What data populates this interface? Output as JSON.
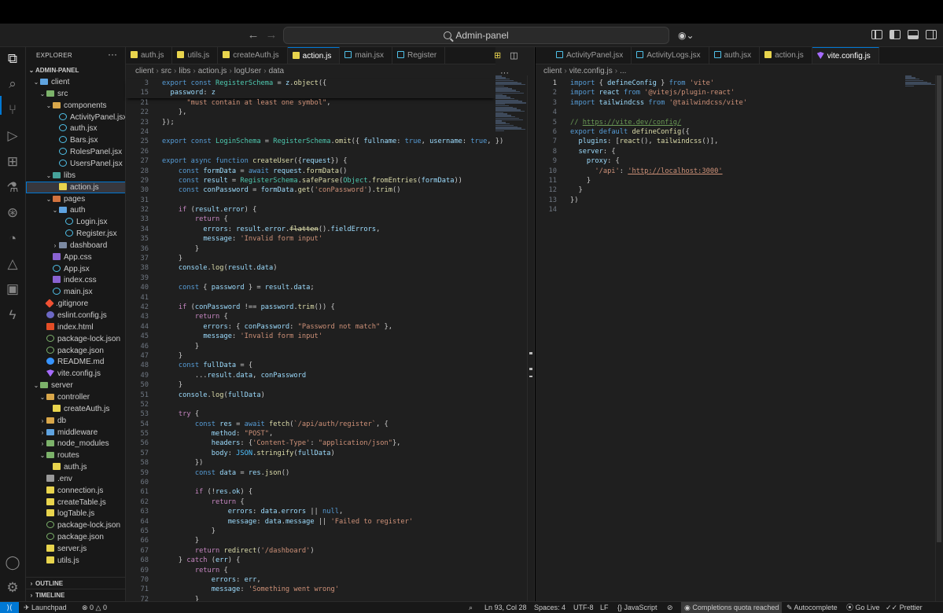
{
  "titlebar": {
    "search_text": "Admin-panel",
    "back_icon": "arrow-left-icon",
    "forward_icon": "arrow-right-icon",
    "copilot_icon": "copilot-icon"
  },
  "activity_bar": {
    "items": [
      "explorer-icon",
      "search-icon",
      "source-control-icon",
      "run-debug-icon",
      "extensions-icon",
      "testing-icon",
      "git-graph-icon",
      "remote-icon",
      "azure-icon",
      "container-icon",
      "thunder-client-icon"
    ],
    "bottom": [
      "account-icon",
      "settings-gear-icon"
    ]
  },
  "sidebar": {
    "title": "EXPLORER",
    "more": "···",
    "root": "ADMIN-PANEL",
    "tree": [
      {
        "label": "client",
        "depth": 1,
        "chev": "⌄",
        "icon": "ic-folder-blue"
      },
      {
        "label": "src",
        "depth": 2,
        "chev": "⌄",
        "icon": "ic-folder-green"
      },
      {
        "label": "components",
        "depth": 3,
        "chev": "⌄",
        "icon": "ic-folder"
      },
      {
        "label": "ActivityPanel.jsx",
        "depth": 4,
        "chev": "",
        "icon": "ic-react"
      },
      {
        "label": "auth.jsx",
        "depth": 4,
        "chev": "",
        "icon": "ic-react"
      },
      {
        "label": "Bars.jsx",
        "depth": 4,
        "chev": "",
        "icon": "ic-react"
      },
      {
        "label": "RolesPanel.jsx",
        "depth": 4,
        "chev": "",
        "icon": "ic-react"
      },
      {
        "label": "UsersPanel.jsx",
        "depth": 4,
        "chev": "",
        "icon": "ic-react"
      },
      {
        "label": "libs",
        "depth": 3,
        "chev": "⌄",
        "icon": "ic-folder-teal"
      },
      {
        "label": "action.js",
        "depth": 4,
        "chev": "",
        "icon": "ic-js",
        "selected": true
      },
      {
        "label": "pages",
        "depth": 3,
        "chev": "⌄",
        "icon": "ic-folder-red"
      },
      {
        "label": "auth",
        "depth": 4,
        "chev": "⌄",
        "icon": "ic-folder-blue"
      },
      {
        "label": "Login.jsx",
        "depth": 5,
        "chev": "",
        "icon": "ic-react"
      },
      {
        "label": "Register.jsx",
        "depth": 5,
        "chev": "",
        "icon": "ic-react"
      },
      {
        "label": "dashboard",
        "depth": 4,
        "chev": "›",
        "icon": "ic-folder-gray"
      },
      {
        "label": "App.css",
        "depth": 3,
        "chev": "",
        "icon": "ic-css"
      },
      {
        "label": "App.jsx",
        "depth": 3,
        "chev": "",
        "icon": "ic-react"
      },
      {
        "label": "index.css",
        "depth": 3,
        "chev": "",
        "icon": "ic-css"
      },
      {
        "label": "main.jsx",
        "depth": 3,
        "chev": "",
        "icon": "ic-react"
      },
      {
        "label": ".gitignore",
        "depth": 2,
        "chev": "",
        "icon": "ic-git"
      },
      {
        "label": "eslint.config.js",
        "depth": 2,
        "chev": "",
        "icon": "ic-eslint"
      },
      {
        "label": "index.html",
        "depth": 2,
        "chev": "",
        "icon": "ic-html"
      },
      {
        "label": "package-lock.json",
        "depth": 2,
        "chev": "",
        "icon": "ic-json"
      },
      {
        "label": "package.json",
        "depth": 2,
        "chev": "",
        "icon": "ic-json"
      },
      {
        "label": "README.md",
        "depth": 2,
        "chev": "",
        "icon": "ic-info"
      },
      {
        "label": "vite.config.js",
        "depth": 2,
        "chev": "",
        "icon": "ic-vite"
      },
      {
        "label": "server",
        "depth": 1,
        "chev": "⌄",
        "icon": "ic-folder-green"
      },
      {
        "label": "controller",
        "depth": 2,
        "chev": "⌄",
        "icon": "ic-folder"
      },
      {
        "label": "createAuth.js",
        "depth": 3,
        "chev": "",
        "icon": "ic-js"
      },
      {
        "label": "db",
        "depth": 2,
        "chev": "›",
        "icon": "ic-folder"
      },
      {
        "label": "middleware",
        "depth": 2,
        "chev": "›",
        "icon": "ic-folder-blue"
      },
      {
        "label": "node_modules",
        "depth": 2,
        "chev": "›",
        "icon": "ic-folder-green"
      },
      {
        "label": "routes",
        "depth": 2,
        "chev": "⌄",
        "icon": "ic-folder-green"
      },
      {
        "label": "auth.js",
        "depth": 3,
        "chev": "",
        "icon": "ic-js"
      },
      {
        "label": ".env",
        "depth": 2,
        "chev": "",
        "icon": "ic-env"
      },
      {
        "label": "connection.js",
        "depth": 2,
        "chev": "",
        "icon": "ic-js"
      },
      {
        "label": "createTable.js",
        "depth": 2,
        "chev": "",
        "icon": "ic-js"
      },
      {
        "label": "logTable.js",
        "depth": 2,
        "chev": "",
        "icon": "ic-js"
      },
      {
        "label": "package-lock.json",
        "depth": 2,
        "chev": "",
        "icon": "ic-json"
      },
      {
        "label": "package.json",
        "depth": 2,
        "chev": "",
        "icon": "ic-json"
      },
      {
        "label": "server.js",
        "depth": 2,
        "chev": "",
        "icon": "ic-js"
      },
      {
        "label": "utils.js",
        "depth": 2,
        "chev": "",
        "icon": "ic-js"
      }
    ],
    "outline": "OUTLINE",
    "timeline": "TIMELINE"
  },
  "editor_left": {
    "tabs": [
      {
        "label": "auth.js",
        "icon": "ic-js",
        "active": false
      },
      {
        "label": "utils.js",
        "icon": "ic-js",
        "active": false
      },
      {
        "label": "createAuth.js",
        "icon": "ic-js",
        "active": false
      },
      {
        "label": "action.js",
        "icon": "ic-js",
        "active": true
      },
      {
        "label": "main.jsx",
        "icon": "ic-react",
        "active": false
      },
      {
        "label": "Register",
        "icon": "ic-react",
        "active": false
      }
    ],
    "breadcrumb": [
      "client",
      "src",
      "libs",
      "action.js",
      "logUser",
      "data"
    ],
    "sticky": [
      {
        "n": "3",
        "t": "export const RegisterSchema = z.object({"
      },
      {
        "n": "15",
        "t": "  password: z"
      }
    ],
    "lines": [
      {
        "n": "21",
        "t": "      \"must contain at least one symbol\","
      },
      {
        "n": "22",
        "t": "    },"
      },
      {
        "n": "23",
        "t": "});"
      },
      {
        "n": "24",
        "t": ""
      },
      {
        "n": "25",
        "t": "export const LoginSchema = RegisterSchema.omit({ fullname: true, username: true, })"
      },
      {
        "n": "26",
        "t": ""
      },
      {
        "n": "27",
        "t": "export async function createUser({request}) {"
      },
      {
        "n": "28",
        "t": "    const formData = await request.formData()"
      },
      {
        "n": "29",
        "t": "    const result = RegisterSchema.safeParse(Object.fromEntries(formData))"
      },
      {
        "n": "30",
        "t": "    const conPassword = formData.get('conPassword').trim()"
      },
      {
        "n": "31",
        "t": ""
      },
      {
        "n": "32",
        "t": "    if (result.error) {"
      },
      {
        "n": "33",
        "t": "        return {"
      },
      {
        "n": "34",
        "t": "          errors: result.error.flatten().fieldErrors,"
      },
      {
        "n": "35",
        "t": "          message: 'Invalid form input'"
      },
      {
        "n": "36",
        "t": "        }"
      },
      {
        "n": "37",
        "t": "    }"
      },
      {
        "n": "38",
        "t": "    console.log(result.data)"
      },
      {
        "n": "39",
        "t": ""
      },
      {
        "n": "40",
        "t": "    const { password } = result.data;"
      },
      {
        "n": "41",
        "t": ""
      },
      {
        "n": "42",
        "t": "    if (conPassword !== password.trim()) {"
      },
      {
        "n": "43",
        "t": "        return {"
      },
      {
        "n": "44",
        "t": "          errors: { conPassword: \"Password not match\" },"
      },
      {
        "n": "45",
        "t": "          message: 'Invalid form input'"
      },
      {
        "n": "46",
        "t": "        }"
      },
      {
        "n": "47",
        "t": "    }"
      },
      {
        "n": "48",
        "t": "    const fullData = {"
      },
      {
        "n": "49",
        "t": "        ...result.data, conPassword"
      },
      {
        "n": "50",
        "t": "    }"
      },
      {
        "n": "51",
        "t": "    console.log(fullData)"
      },
      {
        "n": "52",
        "t": ""
      },
      {
        "n": "53",
        "t": "    try {"
      },
      {
        "n": "54",
        "t": "        const res = await fetch(`/api/auth/register`, {"
      },
      {
        "n": "55",
        "t": "            method: \"POST\","
      },
      {
        "n": "56",
        "t": "            headers: {'Content-Type': \"application/json\"},"
      },
      {
        "n": "57",
        "t": "            body: JSON.stringify(fullData)"
      },
      {
        "n": "58",
        "t": "        })"
      },
      {
        "n": "59",
        "t": "        const data = res.json()"
      },
      {
        "n": "60",
        "t": ""
      },
      {
        "n": "61",
        "t": "        if (!res.ok) {"
      },
      {
        "n": "62",
        "t": "            return {"
      },
      {
        "n": "63",
        "t": "                errors: data.errors || null,"
      },
      {
        "n": "64",
        "t": "                message: data.message || 'Failed to register'"
      },
      {
        "n": "65",
        "t": "            }"
      },
      {
        "n": "66",
        "t": "        }"
      },
      {
        "n": "67",
        "t": "        return redirect('/dashboard')"
      },
      {
        "n": "68",
        "t": "    } catch (err) {"
      },
      {
        "n": "69",
        "t": "        return {"
      },
      {
        "n": "70",
        "t": "            errors: err,"
      },
      {
        "n": "71",
        "t": "            message: 'Something went wrong'"
      },
      {
        "n": "72",
        "t": "        }"
      }
    ]
  },
  "editor_right": {
    "tabs": [
      {
        "label": "ActivityPanel.jsx",
        "icon": "ic-react",
        "active": false
      },
      {
        "label": "ActivityLogs.jsx",
        "icon": "ic-react",
        "active": false
      },
      {
        "label": "auth.jsx",
        "icon": "ic-react",
        "active": false
      },
      {
        "label": "action.js",
        "icon": "ic-js",
        "active": false
      },
      {
        "label": "vite.config.js",
        "icon": "ic-vite",
        "active": true
      }
    ],
    "breadcrumb": [
      "client",
      "vite.config.js",
      "..."
    ],
    "lines": [
      {
        "n": "1",
        "t": "import { defineConfig } from 'vite'"
      },
      {
        "n": "2",
        "t": "import react from '@vitejs/plugin-react'"
      },
      {
        "n": "3",
        "t": "import tailwindcss from '@tailwindcss/vite'"
      },
      {
        "n": "4",
        "t": ""
      },
      {
        "n": "5",
        "t": "// https://vite.dev/config/"
      },
      {
        "n": "6",
        "t": "export default defineConfig({"
      },
      {
        "n": "7",
        "t": "  plugins: [react(), tailwindcss()],"
      },
      {
        "n": "8",
        "t": "  server: {"
      },
      {
        "n": "9",
        "t": "    proxy: {"
      },
      {
        "n": "10",
        "t": "      '/api': 'http://localhost:3000'"
      },
      {
        "n": "11",
        "t": "    }"
      },
      {
        "n": "12",
        "t": "  }"
      },
      {
        "n": "13",
        "t": "})"
      },
      {
        "n": "14",
        "t": ""
      }
    ]
  },
  "statusbar": {
    "launchpad": "Launchpad",
    "problems": "⊗ 0 △ 0",
    "position": "Ln 93, Col 28",
    "spaces": "Spaces: 4",
    "encoding": "UTF-8",
    "eol": "LF",
    "language": "JavaScript",
    "completions": "Completions quota reached",
    "autocomplete": "Autocomplete",
    "golive": "Go Live",
    "prettier": "Prettier"
  },
  "colors": {
    "accent": "#0078d4",
    "keyword": "#569cd6",
    "control": "#c586c0",
    "function": "#dcdcaa",
    "variable": "#9cdcfe",
    "constant": "#4fc1ff",
    "string": "#ce9178",
    "comment": "#6a9955",
    "type": "#4ec9b0"
  }
}
